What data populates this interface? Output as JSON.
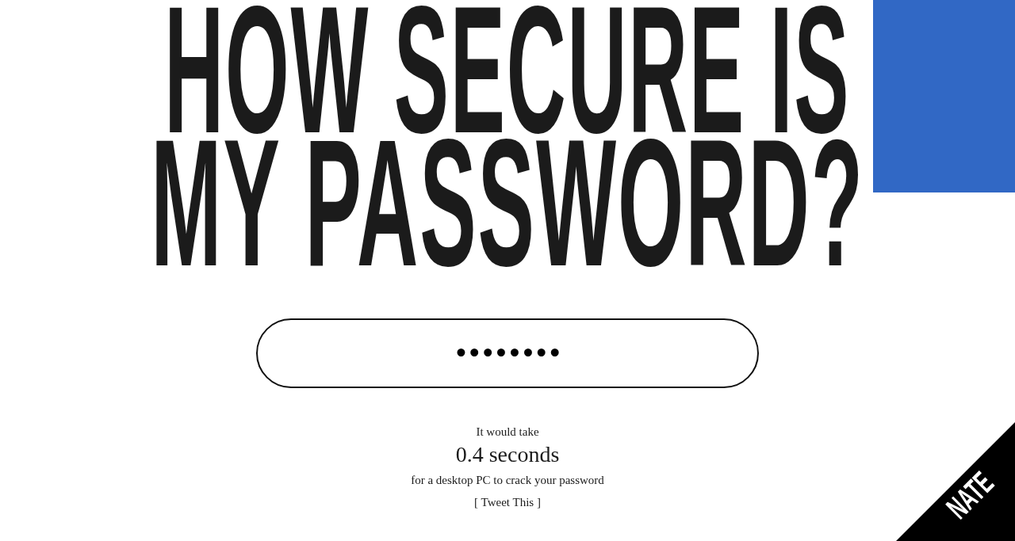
{
  "heading": {
    "lines": [
      "HOW SECURE IS",
      "MY PASSWORD?"
    ]
  },
  "password_field": {
    "value": "••••••••"
  },
  "result": {
    "intro": "It would take",
    "time": "0.4 seconds",
    "detail": "for a desktop PC to crack your password",
    "link": "[ Tweet This ]"
  },
  "corner_ribbon": {
    "label": "NATE"
  }
}
